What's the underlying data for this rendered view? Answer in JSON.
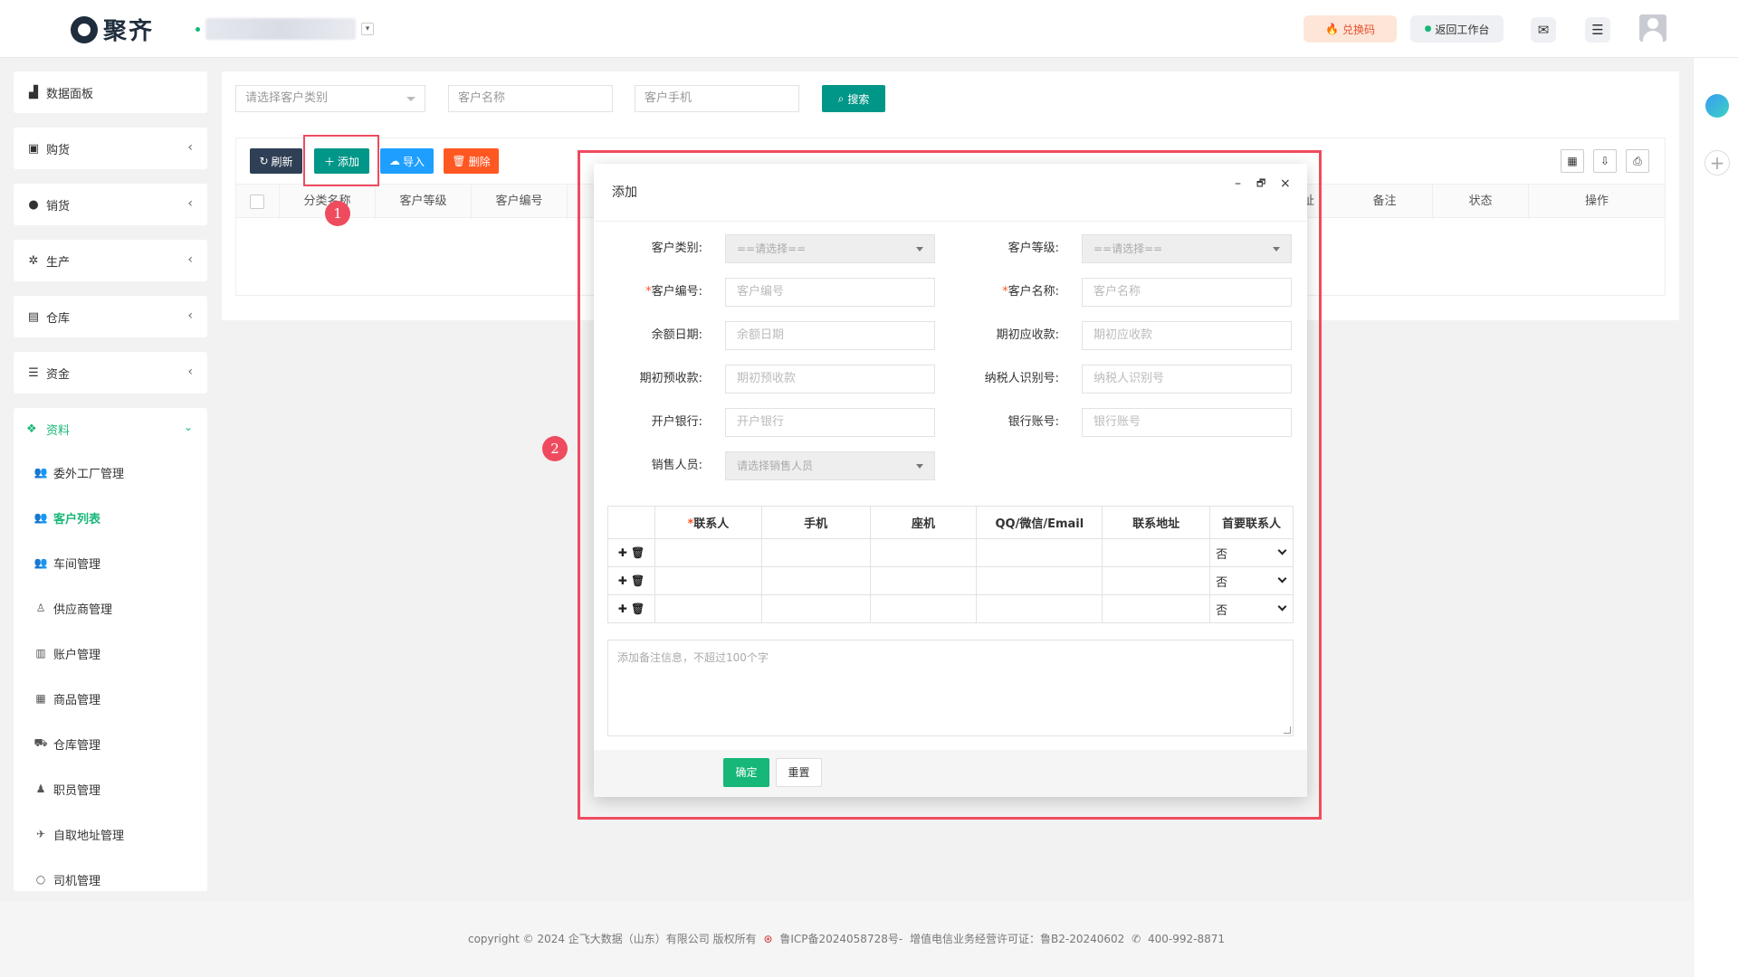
{
  "header": {
    "logo_text": "聚齐",
    "company_name": "",
    "company_caret": "▾",
    "redeem_label": "兑换码",
    "back_label": "返回工作台"
  },
  "sidebar": {
    "items": [
      {
        "label": "数据面板"
      },
      {
        "label": "购货"
      },
      {
        "label": "销货"
      },
      {
        "label": "生产"
      },
      {
        "label": "仓库"
      },
      {
        "label": "资金"
      }
    ],
    "group": {
      "label": "资料",
      "children": [
        {
          "label": "委外工厂管理"
        },
        {
          "label": "客户列表"
        },
        {
          "label": "车间管理"
        },
        {
          "label": "供应商管理"
        },
        {
          "label": "账户管理"
        },
        {
          "label": "商品管理"
        },
        {
          "label": "仓库管理"
        },
        {
          "label": "职员管理"
        },
        {
          "label": "自取地址管理"
        },
        {
          "label": "司机管理"
        }
      ]
    }
  },
  "filters": {
    "category_placeholder": "请选择客户类别",
    "name_placeholder": "客户名称",
    "phone_placeholder": "客户手机",
    "search_label": "搜索"
  },
  "toolbar": {
    "refresh_label": "刷新",
    "add_label": "添加",
    "import_label": "导入",
    "delete_label": "删除"
  },
  "table": {
    "columns_left": [
      "分类名称",
      "客户等级",
      "客户编号"
    ],
    "columns_right": [
      "址",
      "备注",
      "状态",
      "操作"
    ]
  },
  "callouts": [
    "1",
    "2"
  ],
  "modal": {
    "title": "添加",
    "fields": {
      "category_label": "客户类别:",
      "category_value": "==请选择==",
      "level_label": "客户等级:",
      "level_value": "==请选择==",
      "code_label": "客户编号:",
      "code_placeholder": "客户编号",
      "name_label": "客户名称:",
      "name_placeholder": "客户名称",
      "balance_date_label": "余额日期:",
      "balance_date_placeholder": "余额日期",
      "init_receivable_label": "期初应收款:",
      "init_receivable_placeholder": "期初应收款",
      "init_advance_label": "期初预收款:",
      "init_advance_placeholder": "期初预收款",
      "tax_id_label": "纳税人识别号:",
      "tax_id_placeholder": "纳税人识别号",
      "bank_label": "开户银行:",
      "bank_placeholder": "开户银行",
      "account_label": "银行账号:",
      "account_placeholder": "银行账号",
      "sales_label": "销售人员:",
      "sales_value": "请选择销售人员"
    },
    "contacts": {
      "columns": [
        "联系人",
        "手机",
        "座机",
        "QQ/微信/Email",
        "联系地址",
        "首要联系人"
      ],
      "rows": [
        {
          "primary": "否"
        },
        {
          "primary": "否"
        },
        {
          "primary": "否"
        }
      ]
    },
    "remark_placeholder": "添加备注信息，不超过100个字",
    "ok_label": "确定",
    "reset_label": "重置"
  },
  "footer": {
    "copyright": "copyright © 2024 企飞大数据（山东）有限公司 版权所有",
    "icp": "鲁ICP备2024058728号-",
    "license": "增值电信业务经营许可证：鲁B2-20240602",
    "phone": "400-992-8871"
  },
  "colors": {
    "accent_green": "#16b777",
    "teal": "#009688",
    "callout_red": "#ef4b5f"
  }
}
